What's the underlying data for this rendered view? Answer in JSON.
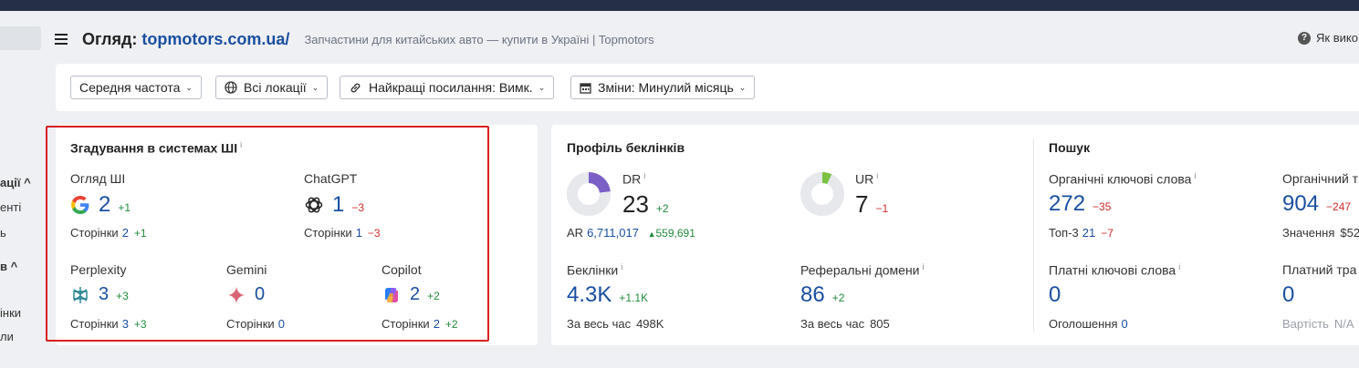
{
  "header": {
    "title_prefix": "Огляд:",
    "domain": "topmotors.com.ua/",
    "subtitle": "Запчастини для китайських авто — купити в Україні | Topmotors",
    "help_label": "Як вико"
  },
  "sidebar_fragments": [
    {
      "text": "ації ^",
      "bold": true
    },
    {
      "text": "енті",
      "bold": false
    },
    {
      "text": "ь",
      "bold": false
    },
    {
      "text": "в ^",
      "bold": true
    },
    {
      "text": "інки",
      "bold": false
    },
    {
      "text": "ли",
      "bold": false
    }
  ],
  "filters": [
    {
      "label": "Середня частота",
      "icon": "none"
    },
    {
      "label": "Всі локації",
      "icon": "globe-icon"
    },
    {
      "label": "Найкращі посилання: Вимк.",
      "icon": "link-icon"
    },
    {
      "label": "Зміни: Минулий місяць",
      "icon": "calendar-icon"
    }
  ],
  "ai_mentions": {
    "title": "Згадування в системах ШІ",
    "info": "i",
    "pages_label": "Сторінки",
    "items": [
      {
        "name": "Огляд ШІ",
        "icon": "google-icon",
        "value": "2",
        "delta": "+1",
        "pages": "2",
        "pages_delta": "+1"
      },
      {
        "name": "ChatGPT",
        "icon": "chatgpt-icon",
        "value": "1",
        "delta": "−3",
        "pages": "1",
        "pages_delta": "−3"
      },
      {
        "name": "Perplexity",
        "icon": "perplexity-icon",
        "value": "3",
        "delta": "+3",
        "pages": "3",
        "pages_delta": "+3"
      },
      {
        "name": "Gemini",
        "icon": "gemini-icon",
        "value": "0",
        "delta": "",
        "pages": "0",
        "pages_delta": ""
      },
      {
        "name": "Copilot",
        "icon": "copilot-icon",
        "value": "2",
        "delta": "+2",
        "pages": "2",
        "pages_delta": "+2"
      }
    ]
  },
  "backlinks": {
    "title": "Профіль беклінків",
    "info": "i",
    "dr": {
      "label": "DR",
      "value": "23",
      "delta": "+2",
      "gauge_fraction": 0.23,
      "gauge_color": "#7b5fc6"
    },
    "ur": {
      "label": "UR",
      "value": "7",
      "delta": "−1",
      "gauge_fraction": 0.07,
      "gauge_color": "#7cc242"
    },
    "ar": {
      "label": "AR",
      "value": "6,711,017",
      "delta": "559,691"
    },
    "backlinks": {
      "label": "Беклінки",
      "value": "4.3K",
      "delta": "+1.1K",
      "all_time_label": "За весь час",
      "all_time": "498K"
    },
    "ref_domains": {
      "label": "Реферальні домени",
      "value": "86",
      "delta": "+2",
      "all_time_label": "За весь час",
      "all_time": "805"
    }
  },
  "search": {
    "title": "Пошук",
    "organic_keywords": {
      "label": "Органічні ключові слова",
      "value": "272",
      "delta": "−35",
      "top3_label": "Топ-3",
      "top3": "21",
      "top3_delta": "−7"
    },
    "organic_traffic": {
      "label": "Органічний тр",
      "value": "904",
      "delta": "−247",
      "value_label": "Значення",
      "value_amount": "$52"
    },
    "paid_keywords": {
      "label": "Платні ключові слова",
      "value": "0",
      "ads_label": "Оголошення",
      "ads": "0"
    },
    "paid_traffic": {
      "label": "Платний тра",
      "value": "0",
      "cost_label": "Вартість",
      "cost": "N/A"
    }
  }
}
